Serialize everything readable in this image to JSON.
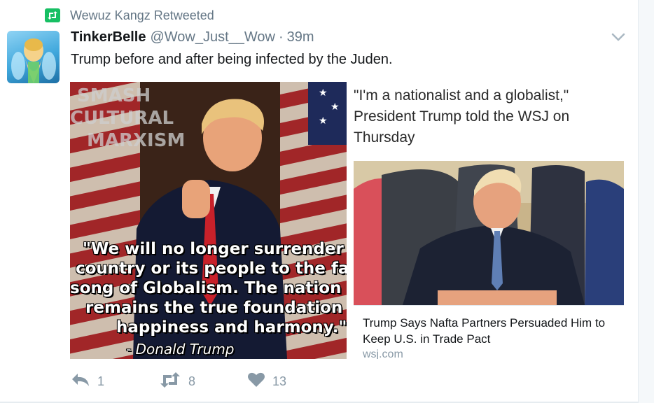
{
  "retweet_context": {
    "icon": "retweet-icon",
    "text": "Wewuz Kangz Retweeted",
    "icon_color": "#17bf63"
  },
  "tweet": {
    "display_name": "TinkerBelle",
    "handle": "@Wow_Just__Wow",
    "separator": "·",
    "time": "39m",
    "text": "Trump before and after being infected by the Juden.",
    "caret_icon": "chevron-down-icon"
  },
  "media": {
    "watermark": [
      "SMASH",
      "CULTURAL",
      "MARXISM"
    ],
    "quote_lines": [
      "\"We will no longer surrender th",
      "country or its people to the fal",
      "song of Globalism. The nation st",
      "remains the true foundation fo",
      "happiness and harmony.\""
    ],
    "attribution": "- Donald Trump"
  },
  "card": {
    "quote_lines": [
      "\"I'm a nationalist and a globalist,\"",
      "President Trump told the WSJ on",
      "Thursday"
    ],
    "title_line1": "Trump Says Nafta Partners Persuaded Him to",
    "title_line2": "Keep U.S. in Trade Pact",
    "domain": "wsj.com"
  },
  "actions": {
    "reply": {
      "icon": "reply-icon",
      "count": "1"
    },
    "retweet": {
      "icon": "retweet-icon",
      "count": "8"
    },
    "like": {
      "icon": "heart-icon",
      "count": "13"
    }
  },
  "colors": {
    "secondary_text": "#657786",
    "action_gray": "#8899a6",
    "retweet_green": "#17bf63"
  }
}
